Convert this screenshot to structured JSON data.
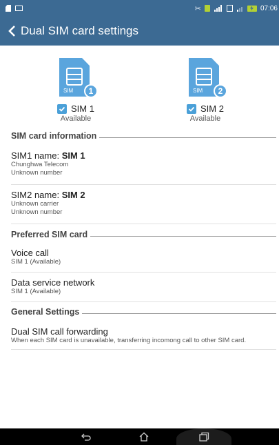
{
  "status_bar": {
    "time": "07:06",
    "icons": [
      "sd-card-icon",
      "image-icon",
      "mute-icon",
      "sim-icon",
      "signal-icon",
      "sim2-icon",
      "signal-weak-icon",
      "battery-charging-icon"
    ]
  },
  "header": {
    "title": "Dual SIM card settings"
  },
  "sims": [
    {
      "badge_text": "SIM",
      "number": "1",
      "name": "SIM 1",
      "status": "Available"
    },
    {
      "badge_text": "SIM",
      "number": "2",
      "name": "SIM 2",
      "status": "Available"
    }
  ],
  "sections": {
    "sim_info": "SIM card information",
    "preferred": "Preferred SIM card",
    "general": "General Settings"
  },
  "sim_info_items": [
    {
      "label": "SIM1 name: ",
      "value": "SIM 1",
      "line1": "Chunghwa Telecom",
      "line2": "Unknown number"
    },
    {
      "label": "SIM2 name: ",
      "value": "SIM 2",
      "line1": "Unknown carrier",
      "line2": "Unknown number"
    }
  ],
  "preferred_items": [
    {
      "title": "Voice call",
      "sub": "SIM 1 (Available)"
    },
    {
      "title": "Data service network",
      "sub": "SIM 1 (Available)"
    }
  ],
  "general_items": [
    {
      "title": "Dual SIM call forwarding",
      "sub": "When each SIM card is unavailable, transferring incomong call to other SIM card."
    }
  ],
  "colors": {
    "header_bg": "#3c6a93",
    "sim_blue": "#5aa5dd",
    "checkbox_blue": "#4aa0d8"
  }
}
